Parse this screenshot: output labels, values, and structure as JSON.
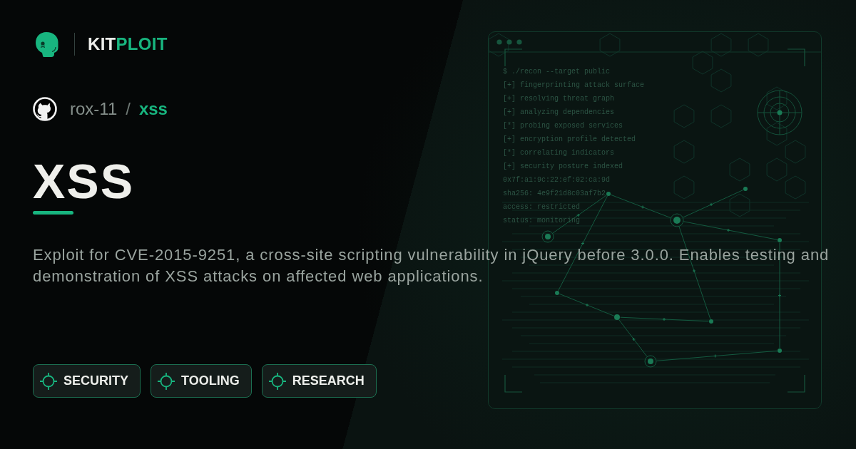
{
  "brand": {
    "prefix": "KIT",
    "accent": "PLOIT"
  },
  "repo": {
    "owner": "rox-11",
    "separator": "/",
    "name": "xss"
  },
  "title": "XSS",
  "description": "Exploit for CVE-2015-9251, a cross-site scripting vulnerability in jQuery before 3.0.0. Enables testing and demonstration of XSS attacks on affected web applications.",
  "tags": [
    "SECURITY",
    "TOOLING",
    "RESEARCH"
  ],
  "terminal": {
    "lines": [
      "$ ./recon --target public",
      "[+] fingerprinting attack surface",
      "[+] resolving threat graph",
      "[+] analyzing dependencies",
      "[*] probing exposed services",
      "[+] encryption profile detected",
      "[*] correlating indicators",
      "[+] security posture indexed",
      "0x7f:a1:9c:22:ef:02:ca:9d",
      "sha256: 4e9f21d8c03af7b2",
      "access: restricted",
      "status: monitoring"
    ]
  }
}
